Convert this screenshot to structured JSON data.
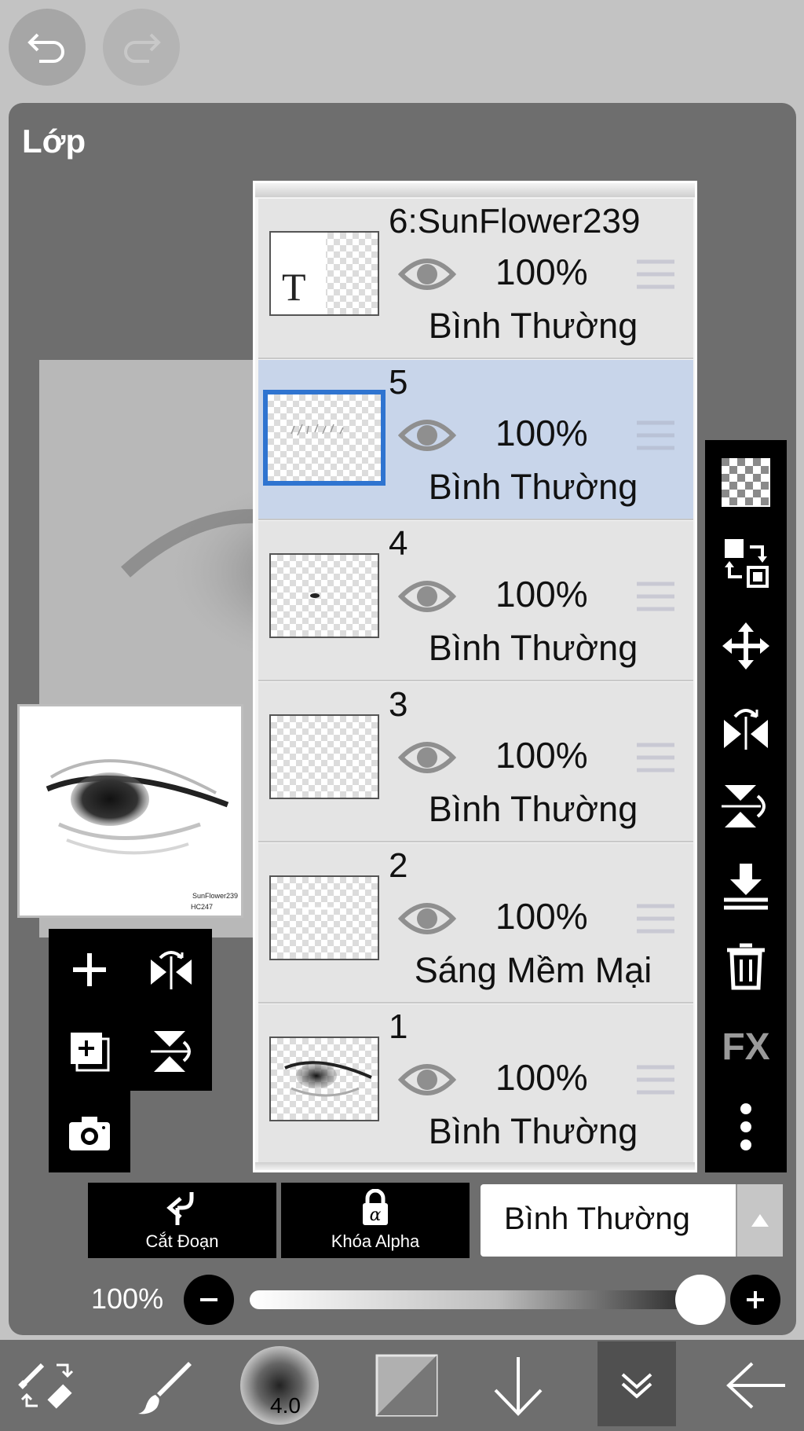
{
  "top": {
    "undo_icon": "undo-arrow",
    "redo_icon": "redo-arrow"
  },
  "panel": {
    "title": "Lớp"
  },
  "watermark": {
    "line1": "SunFlower239",
    "line2": "HC247"
  },
  "layers": [
    {
      "name": "6:SunFlower239",
      "opacity": "100%",
      "blend": "Bình Thường",
      "selected": false,
      "thumb": "text"
    },
    {
      "name": "5",
      "opacity": "100%",
      "blend": "Bình Thường",
      "selected": true,
      "thumb": "lashes"
    },
    {
      "name": "4",
      "opacity": "100%",
      "blend": "Bình Thường",
      "selected": false,
      "thumb": "dot"
    },
    {
      "name": "3",
      "opacity": "100%",
      "blend": "Bình Thường",
      "selected": false,
      "thumb": "empty"
    },
    {
      "name": "2",
      "opacity": "100%",
      "blend": "Sáng Mềm Mại",
      "selected": false,
      "thumb": "faint"
    },
    {
      "name": "1",
      "opacity": "100%",
      "blend": "Bình Thường",
      "selected": false,
      "thumb": "eye"
    }
  ],
  "thumb_text_glyph": "T",
  "right_tools": [
    "transparency-icon",
    "swap-layer-icon",
    "move-icon",
    "flip-horizontal-icon",
    "flip-vertical-icon",
    "merge-down-icon",
    "trash-icon",
    "fx-icon",
    "more-icon"
  ],
  "fx_label": "FX",
  "bottom_controls": {
    "clip_label": "Cắt Đoạn",
    "alpha_lock_label": "Khóa Alpha",
    "blend_mode": "Bình Thường",
    "opacity_label": "100%",
    "opacity_value": 1.0
  },
  "toolbar": {
    "brush_size": "4.0"
  }
}
